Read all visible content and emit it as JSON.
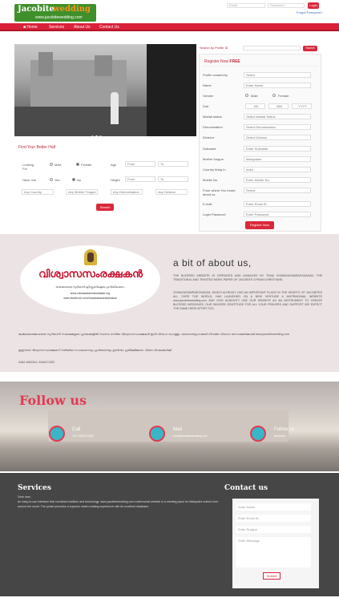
{
  "header": {
    "logo_part1": "Jacobite",
    "logo_part2": "wedding",
    "logo_url": "www.jacobitewedding.com",
    "email_placeholder": "Email",
    "password_placeholder": "Password",
    "login_label": "Login",
    "forgot_label": "Forgot Password?"
  },
  "nav": {
    "items": [
      "Home",
      "Services",
      "About Us",
      "Contact Us"
    ]
  },
  "search_profile": {
    "placeholder": "Search by Profile ID",
    "button": "Search"
  },
  "register": {
    "title_prefix": "Register Now ",
    "title_free": "FREE",
    "fields": [
      {
        "label": "Profile created by",
        "value": "Select"
      },
      {
        "label": "Name",
        "value": "Enter Name"
      },
      {
        "label": "Gender",
        "value": ""
      },
      {
        "label": "Dob",
        "value": ""
      },
      {
        "label": "Marital status",
        "value": "Select Marital Status"
      },
      {
        "label": "Denomination",
        "value": "Select Denomination"
      },
      {
        "label": "Division",
        "value": "Select Division"
      },
      {
        "label": "Subcaste",
        "value": "Enter Subcaste"
      },
      {
        "label": "Mother tongue",
        "value": "Malayalam"
      },
      {
        "label": "Country living in",
        "value": "India"
      },
      {
        "label": "Mobile No.",
        "value": "Enter Mobile No."
      },
      {
        "label": "From where You heard about us",
        "value": "Select"
      },
      {
        "label": "E-mail",
        "value": "Enter Email ID"
      },
      {
        "label": "Login Password",
        "value": "Enter Password"
      }
    ],
    "gender_male": "Male",
    "gender_female": "Female",
    "dob_dd": "DD",
    "dob_mm": "MM",
    "dob_yyyy": "YYYY",
    "submit": "Register Now"
  },
  "find": {
    "title": "Find Your Better Half",
    "looking_for": "Looking For",
    "male": "Male",
    "female": "Female",
    "age": "Age",
    "from": "From",
    "to": "To",
    "have_job": "Have Job",
    "yes": "Yes",
    "no": "No",
    "height": "Height",
    "any_country": "Any Country",
    "any_mother_tongue": "Any Mother Tongue",
    "any_denomination": "Any Denomination",
    "any_division": "Any Division",
    "search": "Search"
  },
  "about": {
    "heading": "a bit of about us,",
    "logo_title": "വിശ്വാസസംരക്ഷകൻ",
    "logo_sub": "യാക്കോബായ സുറിയാനി ക്രിസ്ത്യാനികളുടെ പ്രസിദ്ധീകരണം",
    "logo_site1": "www.viswasasamrakshakan.org",
    "logo_site2": "www.facebook.com/viswasasamrakshakan",
    "p1": "THE BLESSED WEBSITE IS OPERATED AND MANAGED BY TEAM VISWASASAMRAKSHAKAN, THE TRADITIONAL AND TRUSTED NEWS PAPER OF JACOBITE SYRIAN CHRISTIANS.",
    "p2": "VISWASASAMRAKSHAKAN, WHICH ALREADY HAS AN IMPORTANT PLACE IN THE HEARTS OF JACOBITES ALL OVER THE WORLD, HAS LAUNCHED ON A NEW VENTURE A MATRIMONIAL WEBSITE www.jacobitewedding.com MAY GOD ALMIGHTY USE OUR WEBSITE AS AN INSTRUMENT TO CREATE BLESSED WEDDINGS. OUR SINCERE GRATITUDE FOR ALL YOUR PRAYERS AND SUPPORT WE EXPECT THE SAME HERE AFTER TOO.",
    "ml1": "മലങ്കരയാക്കോബായ സുറിയാനി സഭാമക്കളുടെ ഹൃദയങ്ങളിൽ സ്ഥാനം നേടിയ വിശ്വാസസംരക്ഷകൻ ഇനി വിവാഹ രംഗത്തും. ദൈവാനുഗ്രഹങ്ങൾ നിറഞ്ഞ വിവാഹ ബന്ധങ്ങൾക്കായി www.jacobitewedding.com",
    "ml2": "ഇതുവരെ വിശ്വാസസംരക്ഷകന് നൽകിയ സഹകരണവും പ്രാർത്ഥനയും തുടർന്നും പ്രതീക്ഷിക്കുന്നു. വിശദ വിവരങ്ങൾക്ക്",
    "phone": "0484 4960304, 9946471353"
  },
  "follow": {
    "title": "Follow us",
    "call_label": "Call",
    "call_value": "+91 9446471353",
    "mail_label": "Mail",
    "mail_value": "mail@jacobitewedding.com",
    "follow_label": "Follow us",
    "follow_value": "facebook"
  },
  "services": {
    "title": "Services",
    "greeting": "Dear user,",
    "text": "An easy-to-use interface that combines tradition and technology. www.jacobitewedding.com matrimonial website is a meeting place for Malayalee suitors from around the world. The portal promotes a superior match-making experience with its excellent database."
  },
  "contact": {
    "title": "Contact us",
    "name": "Enter Name",
    "email": "Enter Email ID",
    "subject": "Enter Subject",
    "message": "Enter Message",
    "submit": "Submit"
  },
  "colors": {
    "brand_red": "#d9213a",
    "logo_green": "#3f8f2a",
    "logo_orange": "#f7941d",
    "follow_teal": "#3ab5c7"
  }
}
